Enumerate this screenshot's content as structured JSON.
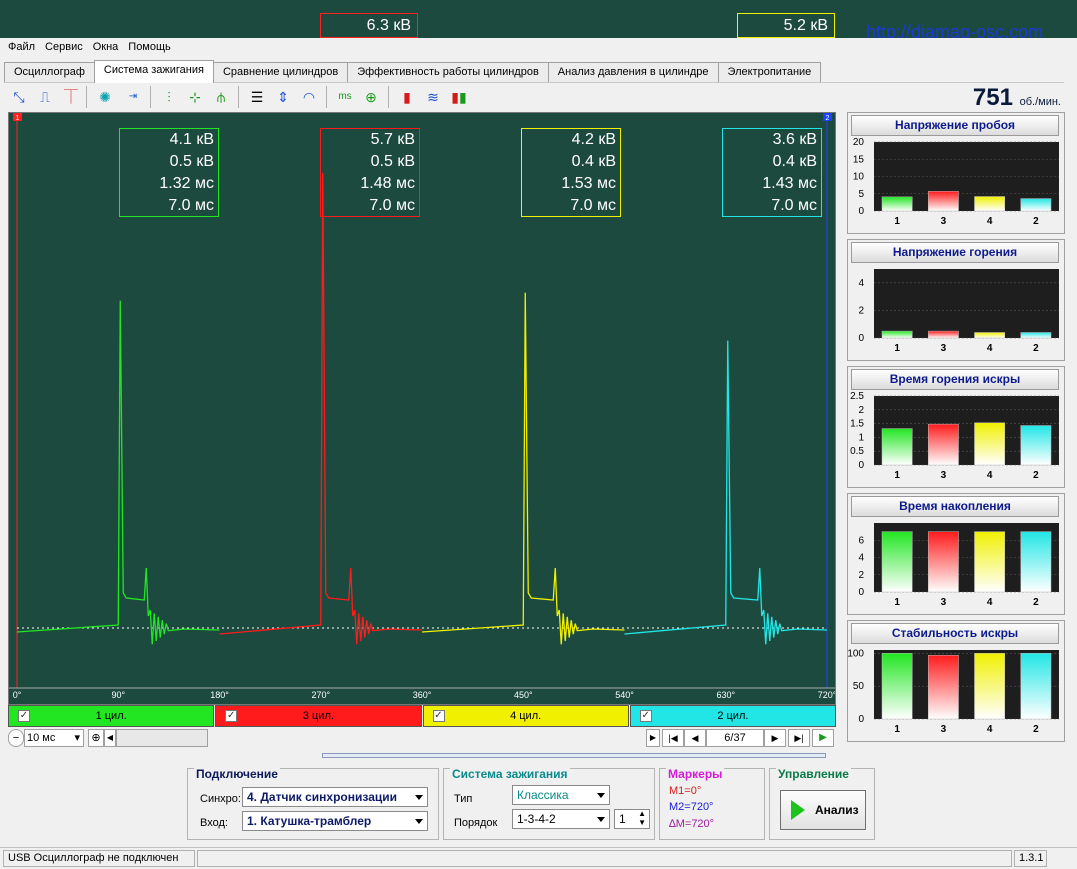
{
  "bg_window": {
    "box1": "6.3 кВ",
    "box2": "5.2 кВ",
    "url": "http://diamag-osc.com"
  },
  "menu": [
    "Файл",
    "Сервис",
    "Окна",
    "Помощь"
  ],
  "tabs": [
    "Осциллограф",
    "Система зажигания",
    "Сравнение цилиндров",
    "Эффективность работы цилиндров",
    "Анализ давления в цилиндре",
    "Электропитание"
  ],
  "active_tab": "Система зажигания",
  "toolbar_icons": [
    "cursor-icon",
    "rise-icon",
    "fall-icon",
    "coil-icon",
    "sequence-icon",
    "overlay-icon",
    "cross-icon",
    "overlay-alt-icon",
    "horizontal-lines-icon",
    "vertical-scale-icon",
    "circle-arrows-icon",
    "ms-icon",
    "plus-wave-icon",
    "bar-red-icon",
    "wave-multi-icon",
    "bar-color-icon"
  ],
  "rpm": {
    "value": "751",
    "unit": "об./мин."
  },
  "cylinders": [
    {
      "label": "1 цил.",
      "color": "#22e622",
      "breakdown": "4.1 кВ",
      "burn": "0.5 кВ",
      "spark_time": "1.32 мс",
      "dwell": "7.0 мс"
    },
    {
      "label": "3 цил.",
      "color": "#ff1b1b",
      "breakdown": "5.7 кВ",
      "burn": "0.5 кВ",
      "spark_time": "1.48 мс",
      "dwell": "7.0 мс"
    },
    {
      "label": "4 цил.",
      "color": "#f0f000",
      "breakdown": "4.2 кВ",
      "burn": "0.4 кВ",
      "spark_time": "1.53 мс",
      "dwell": "7.0 мс"
    },
    {
      "label": "2 цил.",
      "color": "#22e6e6",
      "breakdown": "3.6 кВ",
      "burn": "0.4 кВ",
      "spark_time": "1.43 мс",
      "dwell": "7.0 мс"
    }
  ],
  "marker_badges": [
    "1",
    "2"
  ],
  "x_ticks": [
    "0°",
    "90°",
    "180°",
    "270°",
    "360°",
    "450°",
    "540°",
    "630°",
    "720°"
  ],
  "nav": {
    "timebase": "10 мс",
    "frame": "6/37"
  },
  "chart_data": [
    {
      "type": "bar",
      "title": "Напряжение пробоя",
      "categories": [
        "1",
        "3",
        "4",
        "2"
      ],
      "values": [
        4.1,
        5.7,
        4.2,
        3.6
      ],
      "ylim": [
        0,
        20
      ],
      "yticks": [
        "20",
        "15",
        "10",
        "5",
        "0"
      ]
    },
    {
      "type": "bar",
      "title": "Напряжение горения",
      "categories": [
        "1",
        "3",
        "4",
        "2"
      ],
      "values": [
        0.5,
        0.5,
        0.4,
        0.4
      ],
      "ylim": [
        0,
        5
      ],
      "yticks": [
        "4",
        "2",
        "0"
      ]
    },
    {
      "type": "bar",
      "title": "Время горения искры",
      "categories": [
        "1",
        "3",
        "4",
        "2"
      ],
      "values": [
        1.32,
        1.48,
        1.53,
        1.43
      ],
      "ylim": [
        0,
        2.5
      ],
      "yticks": [
        "2.5",
        "2",
        "1.5",
        "1",
        "0.5",
        "0"
      ]
    },
    {
      "type": "bar",
      "title": "Время накопления",
      "categories": [
        "1",
        "3",
        "4",
        "2"
      ],
      "values": [
        7.0,
        7.0,
        7.0,
        7.0
      ],
      "ylim": [
        0,
        8
      ],
      "yticks": [
        "6",
        "4",
        "2",
        "0"
      ]
    },
    {
      "type": "bar",
      "title": "Стабильность искры",
      "categories": [
        "1",
        "3",
        "4",
        "2"
      ],
      "values": [
        100,
        97,
        100,
        100
      ],
      "ylim": [
        0,
        105
      ],
      "yticks": [
        "100",
        "50",
        "0"
      ]
    }
  ],
  "connection": {
    "title": "Подключение",
    "synchro_label": "Синхро:",
    "synchro_value": "4.  Датчик синхронизации",
    "input_label": "Вход:",
    "input_value": "1.  Катушка-трамблер"
  },
  "ignition": {
    "title": "Система зажигания",
    "type_label": "Тип",
    "type_value": "Классика",
    "order_label": "Порядок",
    "order_value": "1-3-4-2",
    "order_num": "1"
  },
  "markers": {
    "title": "Маркеры",
    "m1": "M1=0°",
    "m2": "M2=720°",
    "dm": "∆M=720°"
  },
  "control": {
    "title": "Управление",
    "analyze": "Анализ"
  },
  "status": {
    "text": "USB Осциллограф не подключен",
    "version": "1.3.1"
  }
}
